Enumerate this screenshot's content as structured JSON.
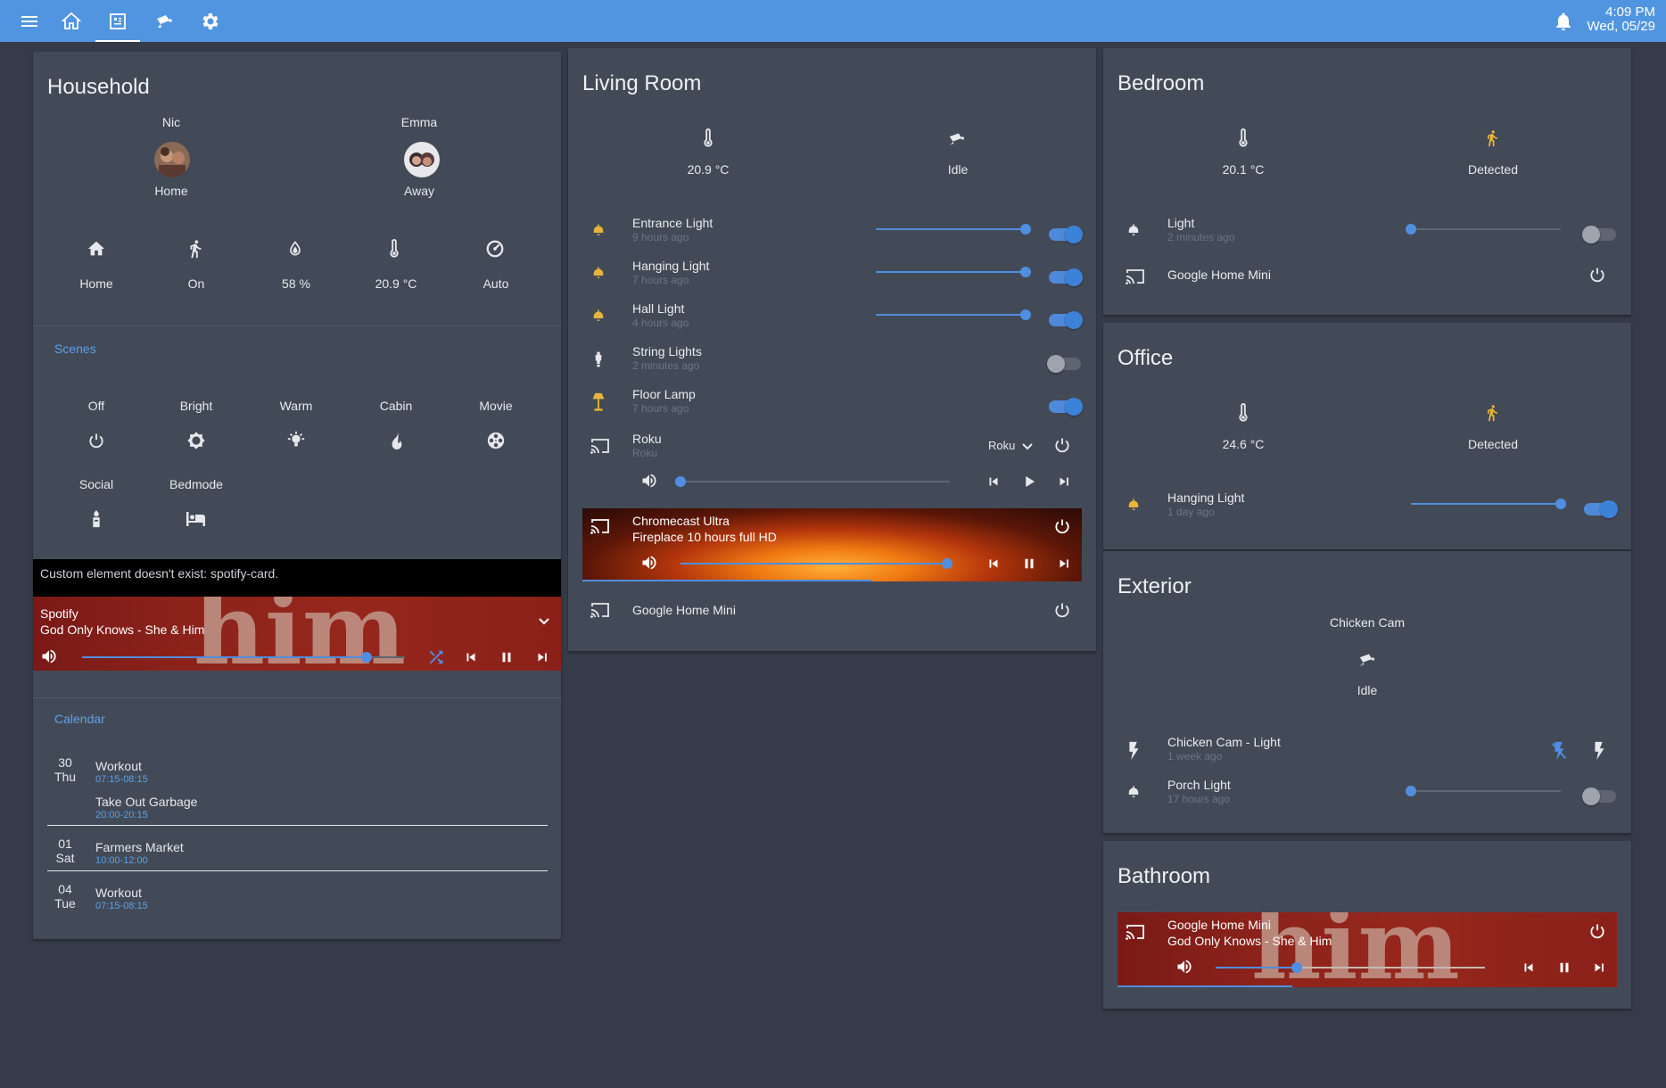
{
  "topbar": {
    "tabs": [
      "menu-icon",
      "home-icon",
      "dashboard-icon",
      "cctv-icon",
      "settings-icon"
    ],
    "time": "4:09 PM",
    "date": "Wed, 05/29",
    "accent": "#5195e1"
  },
  "household": {
    "title": "Household",
    "people": [
      {
        "name": "Nic",
        "state": "Home"
      },
      {
        "name": "Emma",
        "state": "Away"
      }
    ],
    "stats": [
      {
        "icon": "home-icon",
        "label": "Home"
      },
      {
        "icon": "walk-icon",
        "label": "On"
      },
      {
        "icon": "water-drop-icon",
        "label": "58 %"
      },
      {
        "icon": "thermometer-icon",
        "label": "20.9 °C"
      },
      {
        "icon": "gauge-icon",
        "label": "Auto"
      }
    ],
    "scenes_title": "Scenes",
    "scenes": [
      {
        "label": "Off",
        "icon": "power-icon"
      },
      {
        "label": "Bright",
        "icon": "brightness-icon"
      },
      {
        "label": "Warm",
        "icon": "lamp-icon"
      },
      {
        "label": "Cabin",
        "icon": "fire-icon"
      },
      {
        "label": "Movie",
        "icon": "film-reel-icon"
      },
      {
        "label": "Social",
        "icon": "candle-icon"
      },
      {
        "label": "Bedmode",
        "icon": "bed-icon"
      }
    ],
    "error": "Custom element doesn't exist: spotify-card.",
    "spotify": {
      "line1": "Spotify",
      "line2": "God Only Knows - She & Him",
      "volume": 0.88
    },
    "calendar_title": "Calendar",
    "calendar": [
      {
        "day": "30",
        "weekday": "Thu",
        "events": [
          {
            "title": "Workout",
            "time": "07:15-08:15"
          },
          {
            "title": "Take Out Garbage",
            "time": "20:00-20:15"
          }
        ]
      },
      {
        "day": "01",
        "weekday": "Sat",
        "events": [
          {
            "title": "Farmers Market",
            "time": "10:00-12:00"
          }
        ]
      },
      {
        "day": "04",
        "weekday": "Tue",
        "events": [
          {
            "title": "Workout",
            "time": "07:15-08:15"
          }
        ]
      }
    ]
  },
  "living": {
    "title": "Living Room",
    "temp": "20.9 °C",
    "camera": "Idle",
    "lights": [
      {
        "name": "Entrance Light",
        "ago": "9 hours ago",
        "on": true,
        "level": 1.0
      },
      {
        "name": "Hanging Light",
        "ago": "7 hours ago",
        "on": true,
        "level": 1.0
      },
      {
        "name": "Hall Light",
        "ago": "4 hours ago",
        "on": true,
        "level": 1.0
      },
      {
        "name": "String Lights",
        "ago": "2 minutes ago",
        "on": false
      },
      {
        "name": "Floor Lamp",
        "ago": "7 hours ago",
        "on": true
      }
    ],
    "roku": {
      "name": "Roku",
      "sub": "Roku",
      "source": "Roku",
      "volume": 0.0
    },
    "chromecast": {
      "line1": "Chromecast Ultra",
      "line2": "Fireplace 10 hours full HD",
      "volume": 0.99,
      "progress": 0.58
    },
    "google_mini": "Google Home Mini"
  },
  "bedroom": {
    "title": "Bedroom",
    "temp": "20.1 °C",
    "motion": "Detected",
    "light": {
      "name": "Light",
      "ago": "2 minutes ago",
      "on": false,
      "level": 0.0
    },
    "google_mini": "Google Home Mini"
  },
  "office": {
    "title": "Office",
    "temp": "24.6 °C",
    "motion": "Detected",
    "light": {
      "name": "Hanging Light",
      "ago": "1 day ago",
      "on": true,
      "level": 1.0
    }
  },
  "exterior": {
    "title": "Exterior",
    "cam_name": "Chicken Cam",
    "cam_state": "Idle",
    "cam_light": {
      "name": "Chicken Cam - Light",
      "ago": "1 week ago"
    },
    "porch": {
      "name": "Porch Light",
      "ago": "17 hours ago",
      "on": false,
      "level": 0.0
    }
  },
  "bathroom": {
    "title": "Bathroom",
    "line1": "Google Home Mini",
    "line2": "God Only Knows - She & Him",
    "volume": 0.3,
    "progress": 0.35
  }
}
